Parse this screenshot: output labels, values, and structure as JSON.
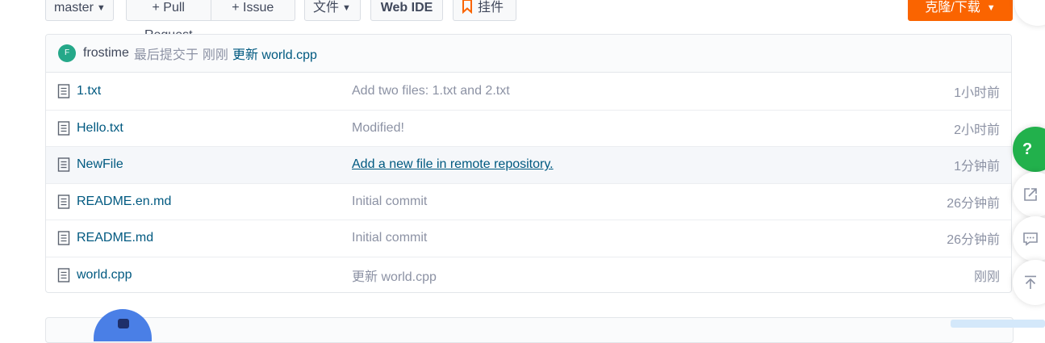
{
  "toolbar": {
    "branch": "master",
    "pull_request": "+ Pull Request",
    "issue": "+ Issue",
    "files": "文件",
    "web_ide": "Web IDE",
    "star": "挂件",
    "clone": "克隆/下载"
  },
  "commit": {
    "avatar_letter": "F",
    "author": "frostime",
    "label": "最后提交于",
    "when": "刚刚",
    "message": "更新 world.cpp"
  },
  "files": [
    {
      "name": "1.txt",
      "message": "Add two files: 1.txt and 2.txt",
      "time": "1小时前"
    },
    {
      "name": "Hello.txt",
      "message": "Modified!",
      "time": "2小时前"
    },
    {
      "name": "NewFile",
      "message": "Add a new file in remote repository.",
      "time": "1分钟前"
    },
    {
      "name": "README.en.md",
      "message": "Initial commit",
      "time": "26分钟前"
    },
    {
      "name": "README.md",
      "message": "Initial commit",
      "time": "26分钟前"
    },
    {
      "name": "world.cpp",
      "message": "更新 world.cpp",
      "time": "刚刚"
    }
  ],
  "side": {
    "help": "?"
  },
  "colors": {
    "accent_orange": "#fa6400",
    "link_blue": "#005980",
    "help_green": "#22b14c"
  }
}
